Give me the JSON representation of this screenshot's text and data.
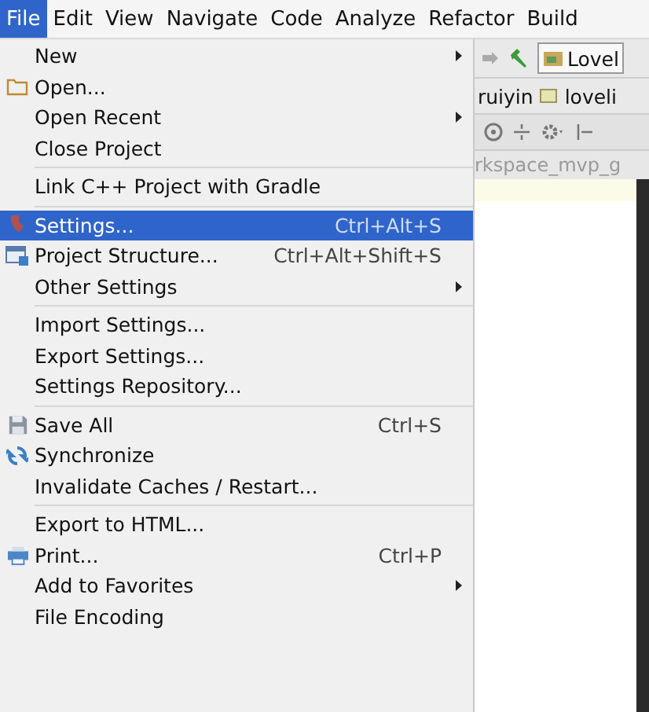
{
  "menubar": [
    {
      "label": "File",
      "selected": true
    },
    {
      "label": "Edit",
      "selected": false
    },
    {
      "label": "View",
      "selected": false
    },
    {
      "label": "Navigate",
      "selected": false
    },
    {
      "label": "Code",
      "selected": false
    },
    {
      "label": "Analyze",
      "selected": false
    },
    {
      "label": "Refactor",
      "selected": false
    },
    {
      "label": "Build",
      "selected": false
    }
  ],
  "file_menu": {
    "sections": [
      [
        {
          "label": "New",
          "kind": "plain",
          "submenu": true,
          "selected": false
        },
        {
          "label": "Open...",
          "kind": "open",
          "submenu": false,
          "selected": false
        },
        {
          "label": "Open Recent",
          "kind": "plain",
          "submenu": true,
          "selected": false
        },
        {
          "label": "Close Project",
          "kind": "plain",
          "submenu": false,
          "selected": false
        }
      ],
      [
        {
          "label": "Link C++ Project with Gradle",
          "kind": "plain",
          "submenu": false,
          "selected": false
        }
      ],
      [
        {
          "label": "Settings...",
          "kind": "settings",
          "shortcut": "Ctrl+Alt+S",
          "submenu": false,
          "selected": true
        },
        {
          "label": "Project Structure...",
          "kind": "structure",
          "shortcut": "Ctrl+Alt+Shift+S",
          "submenu": false,
          "selected": false
        },
        {
          "label": "Other Settings",
          "kind": "plain",
          "submenu": true,
          "selected": false
        }
      ],
      [
        {
          "label": "Import Settings...",
          "kind": "plain",
          "submenu": false,
          "selected": false
        },
        {
          "label": "Export Settings...",
          "kind": "plain",
          "submenu": false,
          "selected": false
        },
        {
          "label": "Settings Repository...",
          "kind": "plain",
          "submenu": false,
          "selected": false
        }
      ],
      [
        {
          "label": "Save All",
          "kind": "save",
          "shortcut": "Ctrl+S",
          "submenu": false,
          "selected": false
        },
        {
          "label": "Synchronize",
          "kind": "sync",
          "submenu": false,
          "selected": false
        },
        {
          "label": "Invalidate Caches / Restart...",
          "kind": "plain",
          "submenu": false,
          "selected": false
        }
      ],
      [
        {
          "label": "Export to HTML...",
          "kind": "plain",
          "submenu": false,
          "selected": false
        },
        {
          "label": "Print...",
          "kind": "print",
          "shortcut": "Ctrl+P",
          "submenu": false,
          "selected": false
        },
        {
          "label": "Add to Favorites",
          "kind": "plain",
          "submenu": true,
          "selected": false
        },
        {
          "label": "File Encoding",
          "kind": "plain",
          "submenu": false,
          "selected": false
        }
      ]
    ]
  },
  "ide": {
    "run_config": "Lovel",
    "breadcrumbs": [
      "ruiyin",
      "loveli"
    ],
    "path_text": "rkspace_mvp_g"
  }
}
